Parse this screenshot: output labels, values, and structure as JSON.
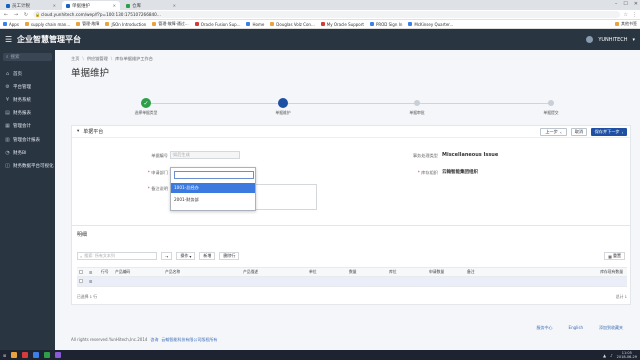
{
  "browser": {
    "tabs": [
      {
        "label": "员工计税"
      },
      {
        "label": "单据维护"
      },
      {
        "label": "仓库"
      }
    ],
    "url": "cloud.yunhitech.com/wep/f?p=100:130:175107266840...",
    "bookmarks": [
      "Apps",
      "supply chain man...",
      "管理·故障",
      "JSOn Introduction",
      "管理·故障·通过...",
      "Oracle Fusion Sup...",
      "Home",
      "Douglas Volz Con...",
      "My Oracle Support",
      "PROD Sign In",
      "McKinsey Quarter..."
    ],
    "bookmarks_right": "其他书签"
  },
  "app": {
    "name": "企业智慧管理平台",
    "user": "YUNHITECH"
  },
  "sidebar": {
    "search_placeholder": "搜索",
    "items": [
      {
        "label": "首页",
        "icon": "home-icon"
      },
      {
        "label": "平台管理",
        "icon": "settings-icon"
      },
      {
        "label": "财务系统",
        "icon": "finance-icon"
      },
      {
        "label": "财务报表",
        "icon": "report-icon"
      },
      {
        "label": "管理会计",
        "icon": "chart-icon"
      },
      {
        "label": "管理会计报表",
        "icon": "report2-icon"
      },
      {
        "label": "财务BI",
        "icon": "bi-icon"
      },
      {
        "label": "财务数据平台可视化",
        "icon": "dashboard-icon"
      }
    ]
  },
  "breadcrumbs": [
    "主页",
    "供应链管理",
    "库存单据维护工作台"
  ],
  "page_title": "单据维护",
  "steps": [
    {
      "label": "选择单据类型",
      "state": "done"
    },
    {
      "label": "单据维护",
      "state": "current"
    },
    {
      "label": "单据审批",
      "state": "todo"
    },
    {
      "label": "单据提交",
      "state": "todo"
    }
  ],
  "header_panel": {
    "title": "单据平台",
    "prev_label": "上一步",
    "cancel_label": "取消",
    "next_label": "保存并下一步",
    "fields": {
      "doc_no_label": "单据编号",
      "doc_no_value": "如后生成",
      "dept_label": "申请部门",
      "remark_label": "备注说明",
      "type_label": "事务处理类型",
      "type_value": "Miscellaneous Issue",
      "org_label": "库存组织",
      "org_value": "云翰智能集团组织"
    },
    "dropdown_options": [
      "1001-总经办",
      "2001-财务部"
    ]
  },
  "detail_panel": {
    "title": "明细",
    "search_placeholder": "搜索: 所有文本列",
    "actions_label": "操作",
    "add_label": "新增",
    "delete_label": "删除行",
    "reset_label": "重置",
    "columns": [
      "行号",
      "产品编码",
      "产品名称",
      "产品描述",
      "单位",
      "数量",
      "库位",
      "申请数量",
      "备注",
      "库存现有数量"
    ],
    "page_info": "已选择 1 行",
    "page_total": "总计 1"
  },
  "footer": {
    "links": [
      "服务中心",
      "English",
      "添加到收藏夹"
    ],
    "copyright": "All rights reserved.YunHitech,Inc.2014",
    "copy_links": [
      "咨询",
      "云翰智能科技有限公司版权所有"
    ]
  },
  "taskbar": {
    "time": "11:05",
    "date": "2018-06-29"
  }
}
